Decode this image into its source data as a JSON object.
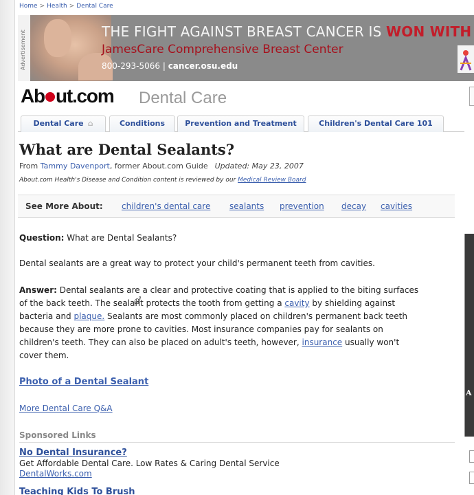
{
  "breadcrumb": [
    "Home",
    "Health",
    "Dental Care"
  ],
  "ad": {
    "side_label": "Advertisement",
    "headline": "THE FIGHT AGAINST BREAST CANCER IS ",
    "headline_emph": "WON WITH",
    "sub": "JamesCare Comprehensive Breast Center",
    "phone": "800-293-5066",
    "url": "cancer.osu.edu"
  },
  "brand": {
    "logo_pre": "Ab",
    "logo_post": "ut.com",
    "section": "Dental Care"
  },
  "tabs": [
    {
      "label": "Dental Care"
    },
    {
      "label": "Conditions"
    },
    {
      "label": "Prevention and Treatment"
    },
    {
      "label": "Children's Dental Care 101"
    }
  ],
  "article": {
    "title": "What are Dental Sealants?",
    "from": "From",
    "author": "Tammy Davenport",
    "author_role": ", former About.com Guide",
    "updated": "Updated: May 23, 2007",
    "review_text": "About.com Health's Disease and Condition content is reviewed by our ",
    "review_link": "Medical Review Board"
  },
  "see_more": {
    "label": "See More About:",
    "links": [
      "children's dental care",
      "sealants",
      "prevention",
      "decay",
      "cavities"
    ]
  },
  "content": {
    "question_label": "Question:",
    "question": " What are Dental Sealants?",
    "intro": "Dental sealants are a great way to protect your child's permanent teeth from cavities.",
    "answer_label": "Answer:",
    "answer_l1": " Dental sealants are a clear and protective coating that is applied to the biting surfaces",
    "answer_l2a": "of the back teeth. The sealant protects the tooth from getting a ",
    "answer_link1": "cavity",
    "answer_l2b": " by shielding against",
    "answer_l3a": "bacteria and ",
    "answer_link2": "plaque.",
    "answer_l3b": " Sealants are most commonly placed on children's permanent back teeth",
    "answer_l4": "because they are more prone to cavities. Most insurance companies pay for sealants on",
    "answer_l5a": "children's teeth. They can also be placed on adult's teeth, however, ",
    "answer_link3": "insurance",
    "answer_l5b": " usually won't",
    "answer_l6": "cover them.",
    "photo_link": "Photo of a Dental Sealant",
    "more_link": "More Dental Care Q&A"
  },
  "sponsored": {
    "label": "Sponsored Links",
    "ads": [
      {
        "title": "No Dental Insurance?",
        "desc": "Get Affordable Dental Care. Low Rates & Caring Dental Service",
        "url": "DentalWorks.com"
      },
      {
        "title": "Teaching Kids To Brush"
      }
    ]
  }
}
